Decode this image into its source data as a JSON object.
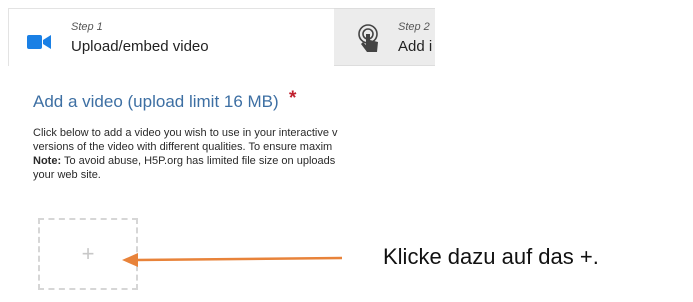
{
  "steps": [
    {
      "number": "Step 1",
      "title": "Upload/embed video",
      "icon": "video-camera-icon",
      "active": true
    },
    {
      "number": "Step 2",
      "title": "Add i",
      "icon": "touch-hand-icon",
      "active": false
    }
  ],
  "field": {
    "label": "Add a video (upload limit 16 MB)",
    "required_mark": "*",
    "description_line1": "Click below to add a video you wish to use in your interactive v",
    "description_line2": "versions of the video with different qualities. To ensure maxim",
    "note_label": "Note:",
    "note_text": " To avoid abuse, H5P.org has limited file size on uploads",
    "description_line4": "your web site."
  },
  "upload": {
    "plus": "+"
  },
  "annotation": {
    "text": "Klicke dazu auf das +."
  },
  "colors": {
    "accent_blue": "#3d6fa3",
    "camera_blue": "#1a80e5",
    "required_red": "#c0202e",
    "arrow_orange": "#e8833a"
  }
}
